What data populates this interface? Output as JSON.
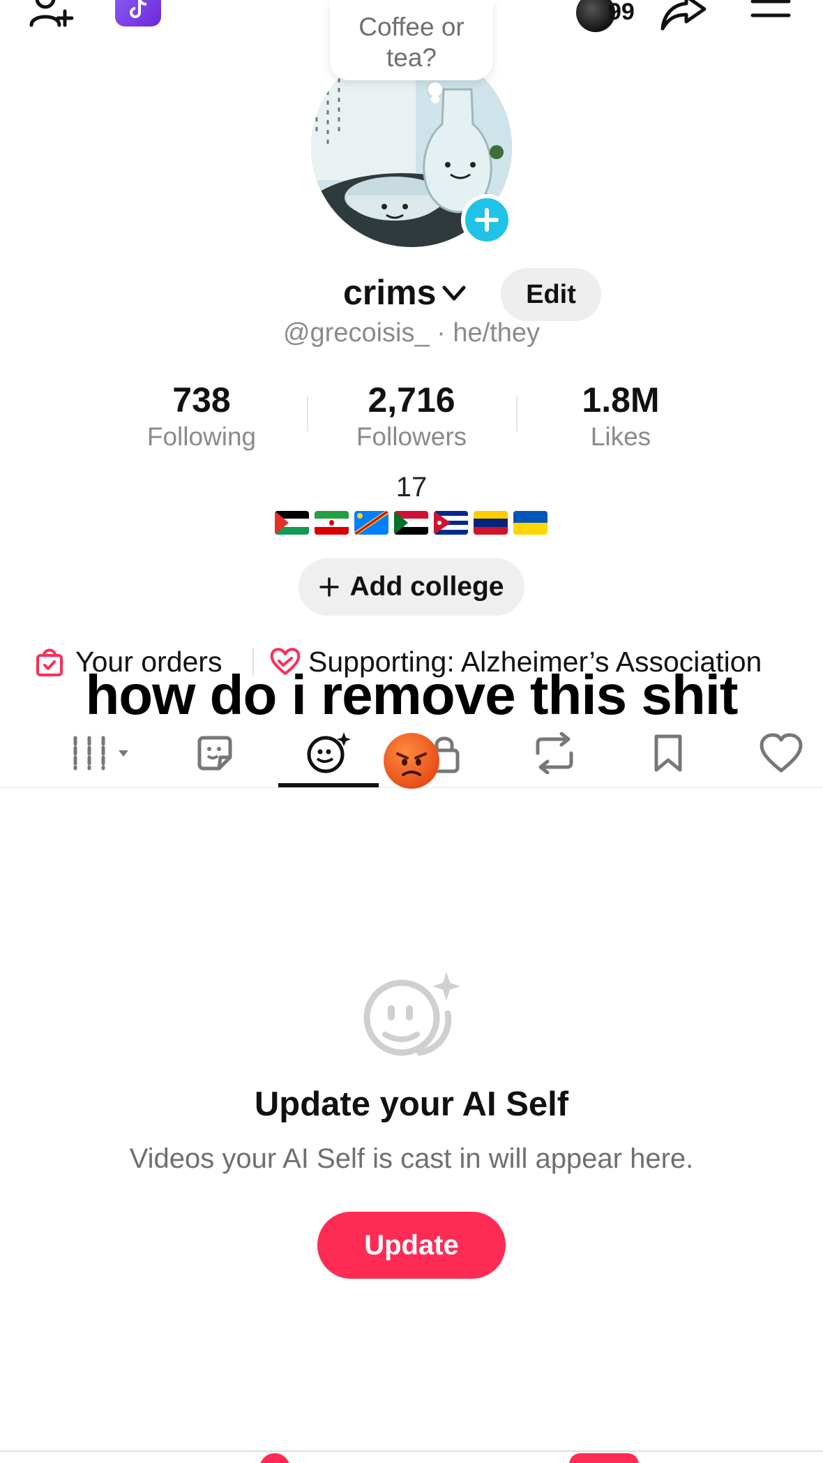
{
  "topbar": {
    "add_friend_icon": "add-user-icon",
    "app_icon": "tiktok-app-icon",
    "notification_count": "99",
    "share_icon": "share-icon",
    "menu_icon": "menu-icon"
  },
  "profile": {
    "note_bubble": "Coffee or tea?",
    "username": "crims",
    "edit_label": "Edit",
    "handle_line": "@grecoisis_ · he/they",
    "stats": [
      {
        "value": "738",
        "label": "Following"
      },
      {
        "value": "2,716",
        "label": "Followers"
      },
      {
        "value": "1.8M",
        "label": "Likes"
      }
    ],
    "bio_number": "17",
    "flags": [
      "Palestine",
      "Iran",
      "DR Congo",
      "Sudan",
      "Cuba",
      "Venezuela",
      "Ukraine"
    ],
    "add_college_label": "Add college"
  },
  "links": {
    "orders_label": "Your orders",
    "supporting_label": "Supporting: Alzheimer’s Association"
  },
  "caption": "how do i remove this shit",
  "tabs": [
    {
      "icon": "grid-icon",
      "active": false
    },
    {
      "icon": "sticker-icon",
      "active": false
    },
    {
      "icon": "ai-self-icon",
      "active": true
    },
    {
      "icon": "lock-icon",
      "active": false
    },
    {
      "icon": "repost-icon",
      "active": false
    },
    {
      "icon": "bookmark-icon",
      "active": false
    },
    {
      "icon": "heart-icon",
      "active": false
    }
  ],
  "empty_state": {
    "title": "Update your AI Self",
    "subtitle": "Videos your AI Self is cast in will appear here.",
    "button_label": "Update"
  },
  "colors": {
    "accent": "#fe2c55",
    "avatar_add": "#20c2e8",
    "muted_text": "#8a8a8a"
  }
}
